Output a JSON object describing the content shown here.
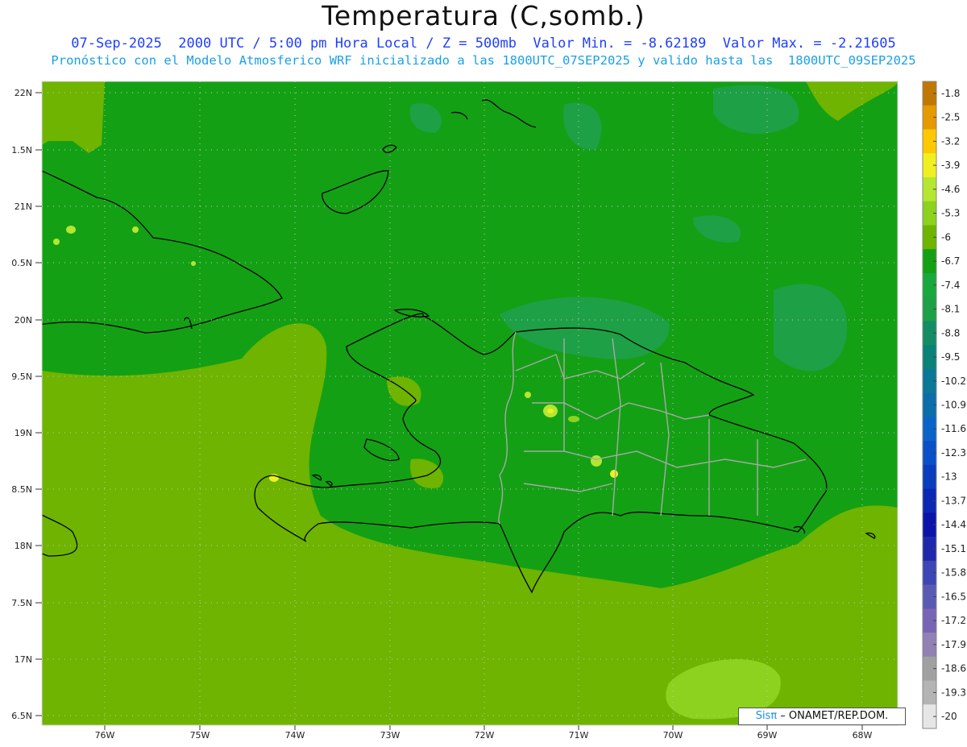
{
  "title": "Temperatura (C,somb.)",
  "subtitle_line1": "07-Sep-2025  2000 UTC / 5:00 pm Hora Local / Z = 500mb  Valor Min. = -8.62189  Valor Max. = -2.21605",
  "subtitle_line2": "Pronóstico con el Modelo Atmosferico WRF inicializado a las 1800UTC_07SEP2025 y valido hasta las  1800UTC_09SEP2025",
  "axes": {
    "lat_labels": [
      "22N",
      "1.5N",
      "21N",
      "0.5N",
      "20N",
      "9.5N",
      "19N",
      "8.5N",
      "18N",
      "7.5N",
      "17N",
      "6.5N"
    ],
    "lon_labels": [
      "76W",
      "75W",
      "74W",
      "73W",
      "72W",
      "71W",
      "70W",
      "69W",
      "68W"
    ]
  },
  "colorbar": {
    "labels": [
      "-1.8",
      "-2.5",
      "-3.2",
      "-3.9",
      "-4.6",
      "-5.3",
      "-6",
      "-6.7",
      "-7.4",
      "-8.1",
      "-8.8",
      "-9.5",
      "-10.2",
      "-10.9",
      "-11.6",
      "-12.3",
      "-13",
      "-13.7",
      "-14.4",
      "-15.1",
      "-15.8",
      "-16.5",
      "-17.2",
      "-17.9",
      "-18.6",
      "-19.3",
      "-20"
    ],
    "colors": [
      "#c07800",
      "#e49a00",
      "#ffc800",
      "#f0f020",
      "#b4e632",
      "#8cd21e",
      "#6eb400",
      "#14a014",
      "#18a83c",
      "#1ea046",
      "#148c64",
      "#0a8278",
      "#0a7896",
      "#0a6eaa",
      "#0a64c8",
      "#0a50c8",
      "#0a3cbe",
      "#0a28b4",
      "#0a14aa",
      "#1e28aa",
      "#3c46b4",
      "#5a5ab4",
      "#7864b4",
      "#9080b4",
      "#a0a0a0",
      "#b4b4b4",
      "#e6e6e6"
    ]
  },
  "credit": {
    "logo": "Sisπ",
    "text": " – ONAMET/REP.DOM."
  }
}
